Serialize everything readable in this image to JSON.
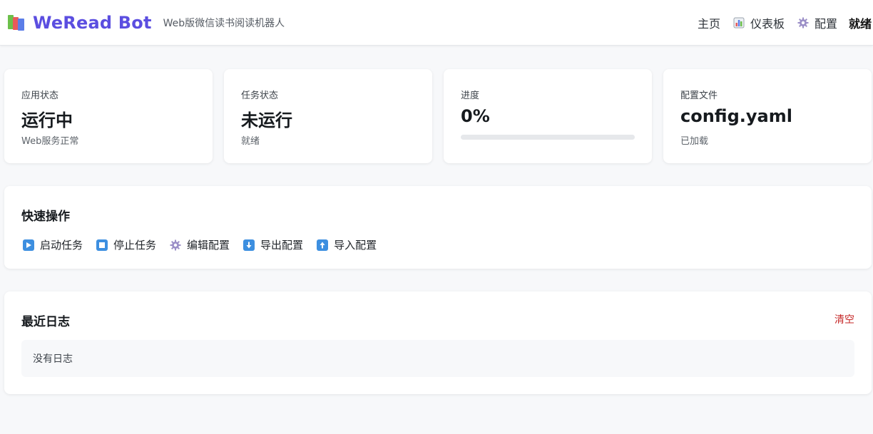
{
  "header": {
    "logo_icon": "books-icon",
    "title": "WeRead Bot",
    "subtitle": "Web版微信读书阅读机器人",
    "nav": {
      "home": "主页",
      "dashboard": "仪表板",
      "dashboard_icon": "bar-chart-icon",
      "config": "配置",
      "config_icon": "gear-icon",
      "status": "就绪"
    }
  },
  "stats": [
    {
      "label": "应用状态",
      "value": "运行中",
      "sub": "Web服务正常"
    },
    {
      "label": "任务状态",
      "value": "未运行",
      "sub": "就绪"
    },
    {
      "label": "进度",
      "value": "0%",
      "progress": 0
    },
    {
      "label": "配置文件",
      "value": "config.yaml",
      "sub": "已加载"
    }
  ],
  "quick_actions": {
    "title": "快速操作",
    "items": [
      {
        "label": "启动任务",
        "icon": "play-icon"
      },
      {
        "label": "停止任务",
        "icon": "stop-icon"
      },
      {
        "label": "编辑配置",
        "icon": "gear-icon"
      },
      {
        "label": "导出配置",
        "icon": "arrow-down-icon"
      },
      {
        "label": "导入配置",
        "icon": "arrow-up-icon"
      }
    ]
  },
  "logs": {
    "title": "最近日志",
    "clear_label": "清空",
    "empty_text": "没有日志"
  },
  "colors": {
    "brand": "#5b4ee0",
    "danger": "#c62828",
    "action_icon": "#3d8fe0"
  }
}
